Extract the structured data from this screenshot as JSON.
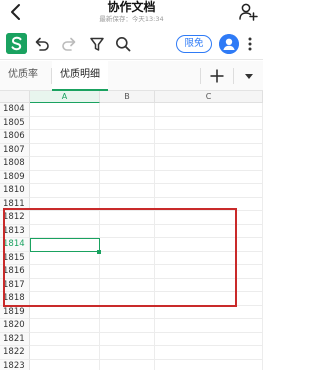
{
  "header": {
    "title": "协作文档",
    "subtitle": "最新保存：今天13:34",
    "back_icon": "back-icon",
    "share_icon": "add-user-icon"
  },
  "toolbar": {
    "app_logo_letter": "S",
    "limit_label": "限免",
    "icons": [
      "undo-icon",
      "redo-icon",
      "filter-icon",
      "search-icon",
      "avatar-icon",
      "more-icon"
    ]
  },
  "tabs": {
    "items": [
      {
        "label": "优质率",
        "active": false
      },
      {
        "label": "优质明细",
        "active": true
      }
    ],
    "add_label": "+"
  },
  "sheet": {
    "columns": [
      "A",
      "B",
      "C"
    ],
    "rows": [
      "1804",
      "1805",
      "1806",
      "1807",
      "1808",
      "1809",
      "1810",
      "1811",
      "1812",
      "1813",
      "1814",
      "1815",
      "1816",
      "1817",
      "1818",
      "1819",
      "1820",
      "1821",
      "1822",
      "1823"
    ],
    "selected_row": "1814",
    "selected_column": "A",
    "highlighted_rows": [
      "1812",
      "1813",
      "1814",
      "1815",
      "1816",
      "1817",
      "1818"
    ]
  },
  "colors": {
    "brand_green": "#1aa260",
    "accent_blue": "#2f7bf6",
    "highlight_red": "#c92a2a"
  }
}
